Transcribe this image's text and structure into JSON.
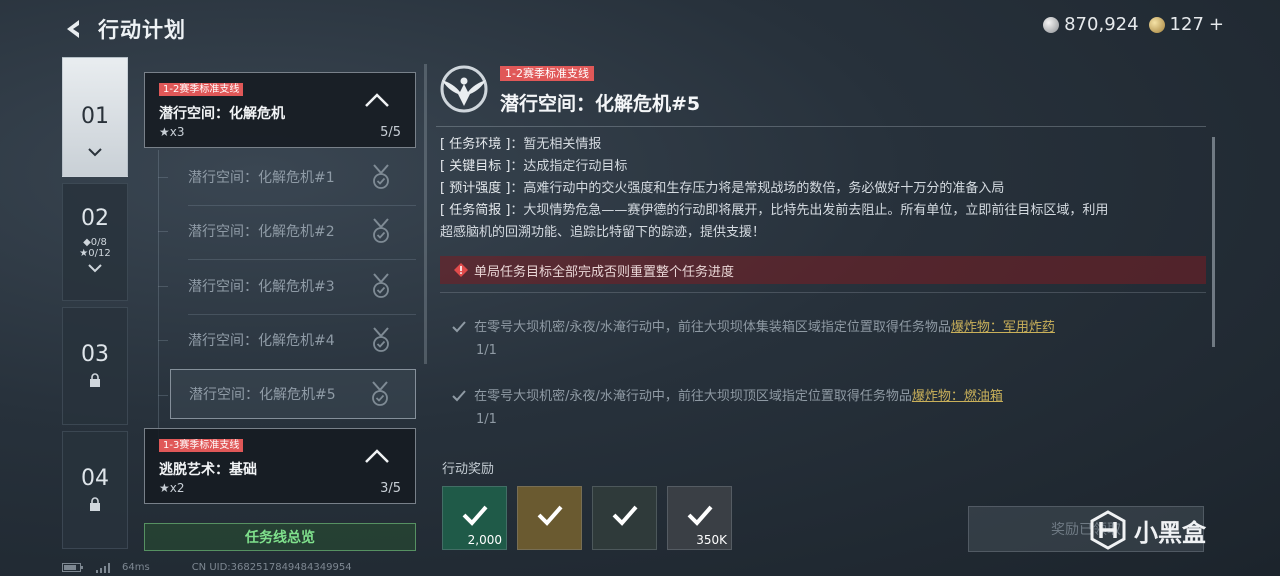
{
  "header": {
    "title": "行动计划"
  },
  "currency": {
    "silver": "870,924",
    "gold": "127",
    "gold_plus": "+"
  },
  "chapters": [
    {
      "num": "01"
    },
    {
      "num": "02",
      "diamonds": "◆0/8",
      "stars": "★0/12"
    },
    {
      "num": "03"
    },
    {
      "num": "04"
    }
  ],
  "mission_groups": [
    {
      "tag": "1-2赛季标准支线",
      "title": "潜行空间：化解危机",
      "stars": "★x3",
      "count": "5/5"
    },
    {
      "tag": "1-3赛季标准支线",
      "title": "逃脱艺术：基础",
      "stars": "★x2",
      "count": "3/5"
    }
  ],
  "sub_missions": [
    {
      "label": "潜行空间：化解危机#1"
    },
    {
      "label": "潜行空间：化解危机#2"
    },
    {
      "label": "潜行空间：化解危机#3"
    },
    {
      "label": "潜行空间：化解危机#4"
    },
    {
      "label": "潜行空间：化解危机#5"
    }
  ],
  "overview_button": "任务线总览",
  "detail": {
    "tag": "1-2赛季标准支线",
    "title": "潜行空间：化解危机#5",
    "env_key": "[ 任务环境 ]",
    "env_val": "：暂无相关情报",
    "target_key": "[ 关键目标 ]",
    "target_val": "：达成指定行动目标",
    "strength_key": "[ 预计强度 ]",
    "strength_val": "：高难行动中的交火强度和生存压力将是常规战场的数倍，务必做好十万分的准备入局",
    "brief_key": "[ 任务简报 ]",
    "brief_val": "：大坝情势危急——赛伊德的行动即将展开，比特先出发前去阻止。所有单位，立即前往目标区域，利用",
    "brief_val2": "超感脑机的回溯功能、追踪比特留下的踪迹，提供支援！",
    "warning": "单局任务目标全部完成否则重置整个任务进度",
    "objectives": [
      {
        "pre": "在零号大坝机密/永夜/水淹行动中，前往大坝坝体集装箱区域指定位置取得任务物品",
        "item": "爆炸物：军用炸药",
        "progress": "1/1"
      },
      {
        "pre": "在零号大坝机密/永夜/水淹行动中，前往大坝坝顶区域指定位置取得任务物品",
        "item": "爆炸物：燃油箱",
        "progress": "1/1"
      }
    ],
    "rewards_label": "行动奖励",
    "rewards": [
      {
        "count": "2,000",
        "color": "#1f5a48"
      },
      {
        "count": "",
        "color": "#6a5a30"
      },
      {
        "count": "",
        "color": "#2f3a3a"
      },
      {
        "count": "350K",
        "color": "#3a3f45"
      }
    ],
    "claim_button": "奖励已领取"
  },
  "watermark": "小黑盒",
  "status": {
    "ping": "64ms",
    "uid": "CN UID:3682517849484349954"
  }
}
